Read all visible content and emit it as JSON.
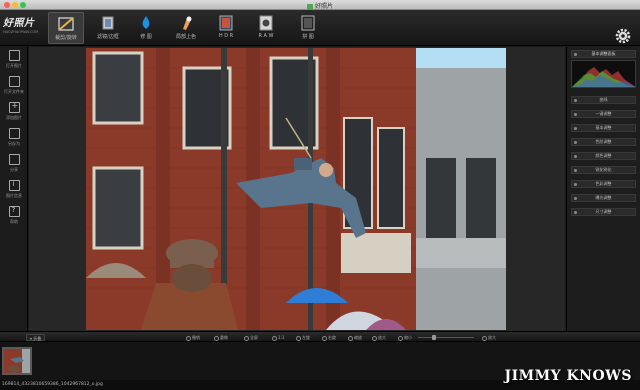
{
  "window": {
    "title": "好照片"
  },
  "logo": {
    "name": "好照片",
    "sub": "HAOZHAOPIAN.COM"
  },
  "toolbar": {
    "tools": [
      {
        "label": "裁剪/旋转",
        "icon": "crop-rotate-icon",
        "active": true
      },
      {
        "label": "滤镜/边框",
        "icon": "filter-frame-icon",
        "active": false
      },
      {
        "label": "修 图",
        "icon": "water-drop-icon",
        "active": false
      },
      {
        "label": "局部上色",
        "icon": "color-brush-icon",
        "active": false
      },
      {
        "label": "H D R",
        "icon": "hdr-icon",
        "active": false
      },
      {
        "label": "R A W",
        "icon": "raw-camera-icon",
        "active": false
      },
      {
        "label": "拼 图",
        "icon": "collage-icon",
        "active": false
      }
    ],
    "settings_icon": "gear-icon"
  },
  "sidebar": {
    "items": [
      {
        "label": "打开图片",
        "icon": "open-image-icon"
      },
      {
        "label": "打开文件夹",
        "icon": "open-folder-icon"
      },
      {
        "label": "添加图片",
        "icon": "add-image-icon"
      },
      {
        "label": "另存为",
        "icon": "save-as-icon"
      },
      {
        "label": "分享",
        "icon": "share-icon"
      },
      {
        "label": "图片信息",
        "icon": "info-icon"
      },
      {
        "label": "帮助",
        "icon": "help-icon"
      }
    ]
  },
  "panel": {
    "header": "基本调整面板",
    "items": [
      "曲线",
      "一键调整",
      "基本调整",
      "色阶调整",
      "颜色调整",
      "锐化锐化",
      "色彩调整",
      "曝光调整",
      "尺寸调整"
    ]
  },
  "bottombar": {
    "left_label": "折叠",
    "buttons": [
      "撤销",
      "重做",
      "全屏",
      "1:1",
      "左旋",
      "右旋",
      "缩放",
      "放大"
    ],
    "zoom_label": "缩小",
    "zoom_in_label": "放大"
  },
  "status": {
    "filename": "169814_4323810659386_1042967812_o.jpg"
  },
  "watermark": "JIMMY KNOWS",
  "colors": {
    "accent": "#3a3a3a",
    "panel_bg": "#1d1d1d",
    "toolbar_bg": "#1b1b1b"
  }
}
